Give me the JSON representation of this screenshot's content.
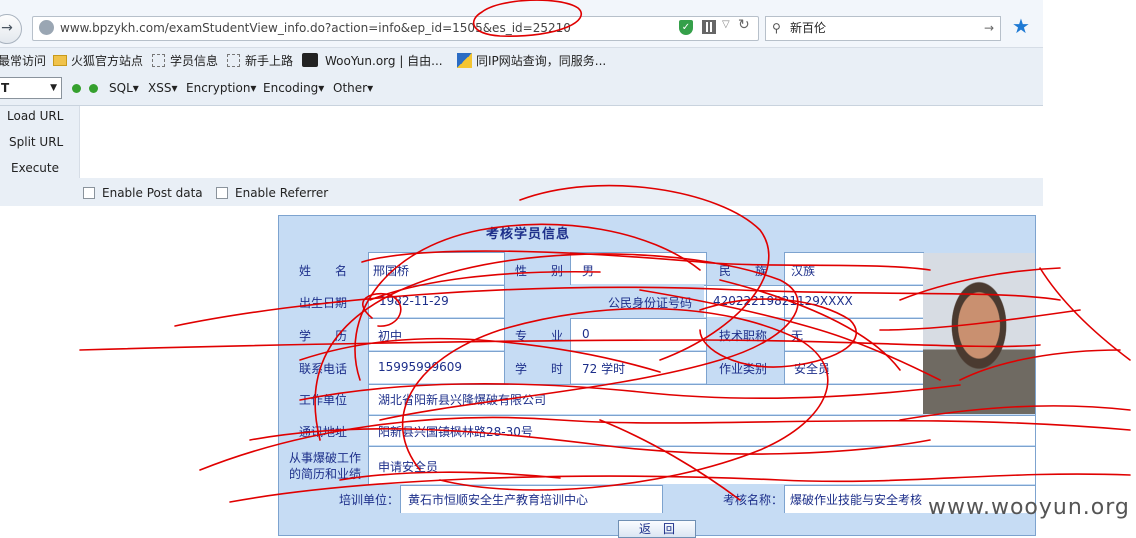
{
  "browser": {
    "nav_back_glyph": "→",
    "url": "www.bpzykh.com/examStudentView_info.do?action=info&ep_id=1505&es_id=25210",
    "search_query": "新百伦"
  },
  "bookmarks": [
    {
      "label": "最常访问"
    },
    {
      "label": "火狐官方站点"
    },
    {
      "label": "学员信息"
    },
    {
      "label": "新手上路"
    },
    {
      "label": "WooYun.org | 自由..."
    },
    {
      "label": "同IP网站查询，同服务..."
    }
  ],
  "hackbar": {
    "selector": "T",
    "menus": [
      "SQL▾",
      "XSS▾",
      "Encryption▾",
      "Encoding▾",
      "Other▾"
    ],
    "load_url": "Load URL",
    "split_url": "Split URL",
    "execute": "Execute",
    "enable_post": "Enable Post data",
    "enable_referrer": "Enable Referrer"
  },
  "form": {
    "title": "考核学员信息",
    "name_label": "姓　　名",
    "name_value": "邢国桥",
    "gender_label": "性　　别",
    "gender_value": "男",
    "ethnic_label": "民　　族",
    "ethnic_value": "汉族",
    "birth_label": "出生日期",
    "birth_value": "1982-11-29",
    "id_label": "公民身份证号码",
    "id_value": "42022219821129XXXX",
    "edu_label": "学　　历",
    "edu_value": "初中",
    "major_label": "专　　业",
    "major_value": "0",
    "title_label": "技术职称",
    "title_value": "无",
    "phone_label": "联系电话",
    "phone_value": "15995999609",
    "hours_label": "学　　时",
    "hours_value": "72 学时",
    "job_label": "作业类别",
    "job_value": "安全员",
    "work_label": "工作单位",
    "work_value": "湖北省阳新县兴隆爆破有限公司",
    "addr_label": "通讯地址",
    "addr_value": "阳新县兴国镇枫林路28-30号",
    "exp_label_1": "从事爆破工作",
    "exp_label_2": "的简历和业绩",
    "exp_value": "申请安全员",
    "train_label": "培训单位：",
    "train_value": "黄石市恒顺安全生产教育培训中心",
    "exam_label": "考核名称：",
    "exam_value": "爆破作业技能与安全考核",
    "back_button": "返　回"
  },
  "watermark": "www.wooyun.org",
  "colors": {
    "accent": "#1d2f8a",
    "header_bg": "#c6dcf4",
    "scribble": "#e00000"
  }
}
